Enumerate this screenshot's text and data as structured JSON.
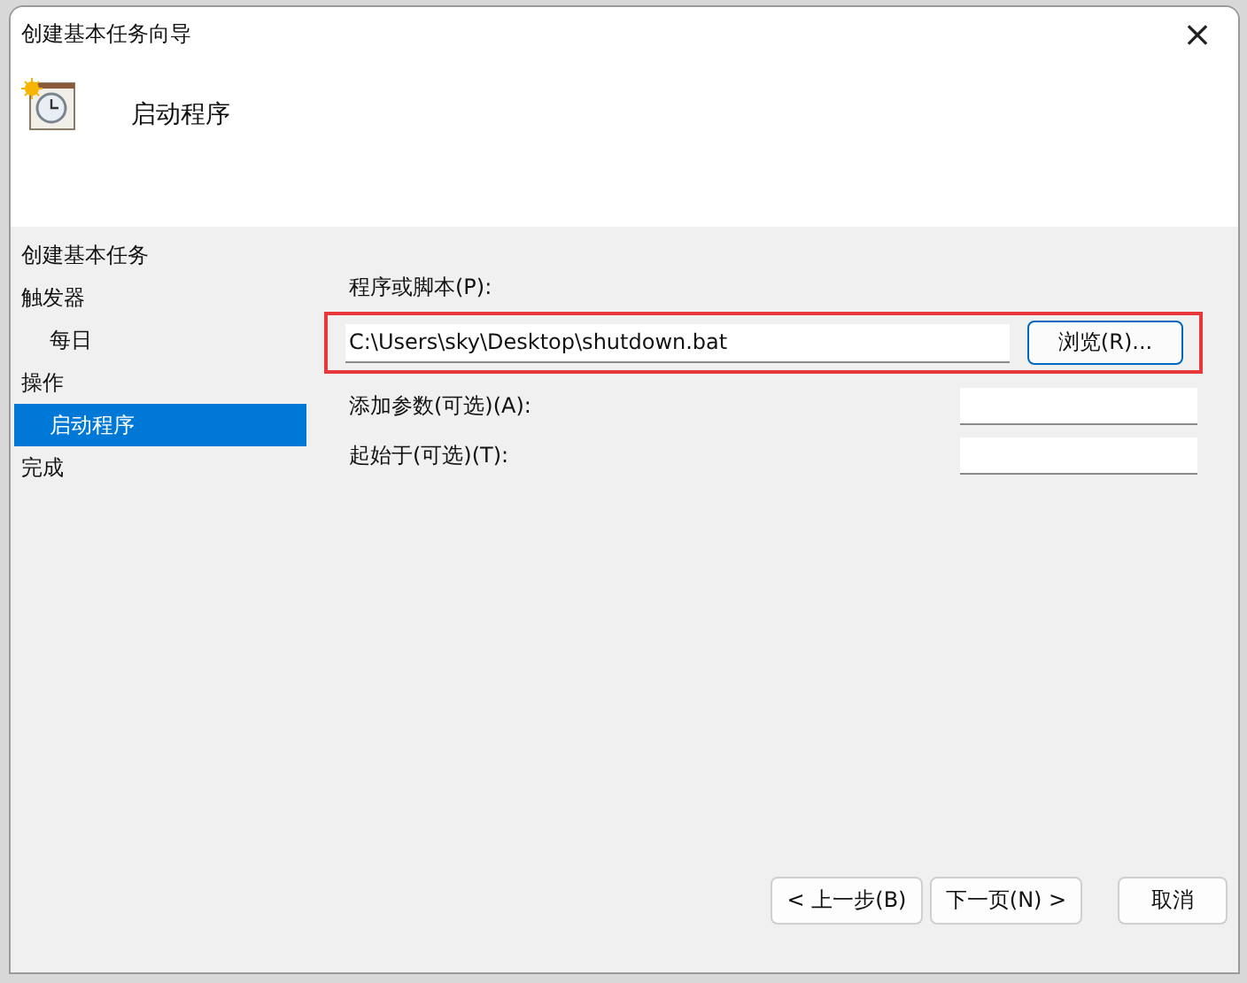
{
  "window": {
    "title": "创建基本任务向导",
    "close": "×"
  },
  "header": {
    "title": "启动程序"
  },
  "steps": [
    {
      "label": "创建基本任务",
      "selected": false
    },
    {
      "label": "触发器",
      "selected": false,
      "children": [
        {
          "label": "每日",
          "selected": false
        }
      ]
    },
    {
      "label": "操作",
      "selected": false,
      "children": [
        {
          "label": "启动程序",
          "selected": true
        }
      ]
    },
    {
      "label": "完成",
      "selected": false
    }
  ],
  "program": {
    "label": "程序或脚本(P):",
    "value": "C:\\Users\\sky\\Desktop\\shutdown.bat",
    "browse": "浏览(R)...",
    "highlighted": true
  },
  "fields": [
    {
      "label": "添加参数(可选)(A):"
    },
    {
      "label": "起始于(可选)(T):"
    }
  ],
  "buttons": [
    "< 上一步(B)",
    "下一页(N) >",
    "取消"
  ]
}
